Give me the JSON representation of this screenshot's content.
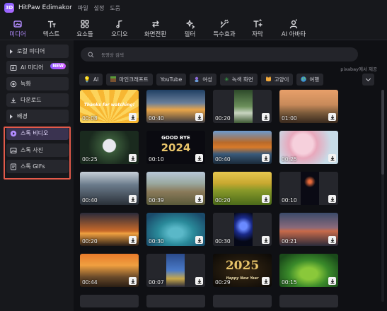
{
  "app": {
    "title": "HitPaw Edimakor",
    "logo_text": "3D",
    "menu": [
      "파일",
      "설정",
      "도움"
    ]
  },
  "toolbar": [
    {
      "label": "미디어",
      "icon": "media-icon",
      "active": true
    },
    {
      "label": "텍스트",
      "icon": "text-icon"
    },
    {
      "label": "요소들",
      "icon": "elements-icon"
    },
    {
      "label": "오디오",
      "icon": "audio-icon"
    },
    {
      "label": "화면전환",
      "icon": "transition-icon"
    },
    {
      "label": "필터",
      "icon": "filter-icon"
    },
    {
      "label": "특수효과",
      "icon": "effects-icon"
    },
    {
      "label": "자막",
      "icon": "subtitle-icon"
    },
    {
      "label": "AI 아바타",
      "icon": "avatar-icon"
    }
  ],
  "sidebar": {
    "items": [
      {
        "label": "로컬 미디어",
        "icon": "folder-icon"
      },
      {
        "label": "AI 미디어",
        "icon": "ai-media-icon",
        "badge": "NEW"
      },
      {
        "label": "녹화",
        "icon": "record-icon"
      },
      {
        "label": "다운로드",
        "icon": "download-icon"
      },
      {
        "label": "배경",
        "icon": "caret-right-icon"
      },
      {
        "label": "스톡 비디오",
        "icon": "play-circle-icon",
        "selected": true
      },
      {
        "label": "스톡 사진",
        "icon": "image-icon"
      },
      {
        "label": "스톡 GIFs",
        "icon": "gif-icon"
      }
    ]
  },
  "search": {
    "placeholder": "동영상 검색"
  },
  "source_note": "pixabay에서 제공",
  "tags": [
    {
      "label": "AI",
      "icon": "lightbulb-icon"
    },
    {
      "label": "마인크래프트",
      "icon": "minecraft-icon"
    },
    {
      "label": "YouTube",
      "icon": ""
    },
    {
      "label": "여성",
      "icon": "woman-icon"
    },
    {
      "label": "녹색 화면",
      "icon": "greenscreen-icon"
    },
    {
      "label": "고양이",
      "icon": "cat-icon"
    },
    {
      "label": "여행",
      "icon": "globe-icon"
    }
  ],
  "videos": [
    {
      "duration": "00:08",
      "scene": "sunburst",
      "overlay_text": "Thanks for watching!"
    },
    {
      "duration": "00:40",
      "scene": "sunrise-clouds"
    },
    {
      "duration": "00:20",
      "scene": "waterfall"
    },
    {
      "duration": "01:00",
      "scene": "desert-sunset"
    },
    {
      "duration": "00:25",
      "scene": "christmas-ornament"
    },
    {
      "duration": "00:10",
      "scene": "goodbye-2024",
      "overlay_text": "GOOD BYE",
      "overlay_year": "2024"
    },
    {
      "duration": "00:40",
      "scene": "autumn-lake"
    },
    {
      "duration": "00:25",
      "scene": "cherry-blossom"
    },
    {
      "duration": "00:40",
      "scene": "ice-cave"
    },
    {
      "duration": "00:39",
      "scene": "grass-field"
    },
    {
      "duration": "00:20",
      "scene": "sunflowers"
    },
    {
      "duration": "00:10",
      "scene": "fireworks"
    },
    {
      "duration": "00:20",
      "scene": "birds-sunset"
    },
    {
      "duration": "00:30",
      "scene": "sea-turtle"
    },
    {
      "duration": "00:30",
      "scene": "jellyfish"
    },
    {
      "duration": "00:21",
      "scene": "mountain-dusk"
    },
    {
      "duration": "00:44",
      "scene": "deer-sunset"
    },
    {
      "duration": "00:07",
      "scene": "city-skyline"
    },
    {
      "duration": "00:29",
      "scene": "happy-new-year-2025",
      "overlay_year": "2025",
      "overlay_sub": "Happy New Year"
    },
    {
      "duration": "00:15",
      "scene": "chameleon"
    }
  ]
}
